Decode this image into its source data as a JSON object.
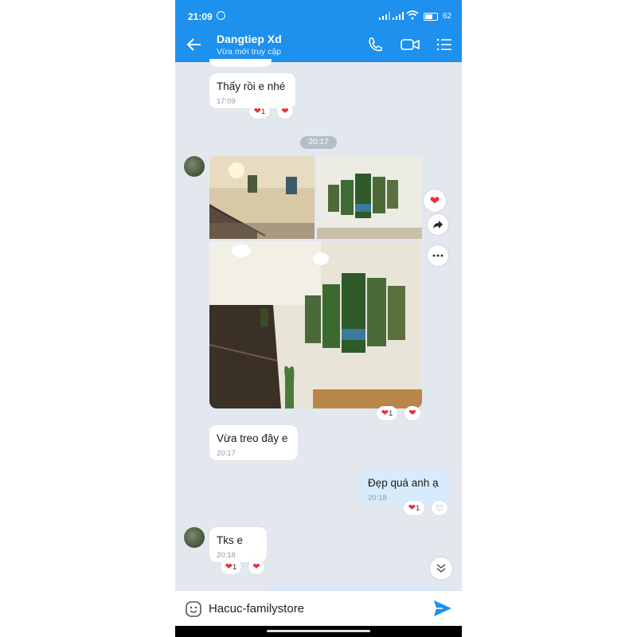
{
  "status_bar": {
    "time": "21:09",
    "battery": "62"
  },
  "header": {
    "name": "Dangtiep Xd",
    "status": "Vừa mới truy cập"
  },
  "messages": {
    "m1": {
      "text": "Thấy rồi e nhé",
      "time": "17:09",
      "reaction_count": "1"
    },
    "divider_time": "20:17",
    "m3": {
      "text": "Vừa treo đây e",
      "time": "20:17"
    },
    "photos_reaction_count": "1",
    "m4": {
      "text": "Đẹp quá anh ạ",
      "time": "20:18",
      "reaction_count": "1"
    },
    "m5": {
      "text": "Tks e",
      "time": "20:18",
      "reaction_count": "1"
    }
  },
  "composer": {
    "text": "Hacuc-familystore"
  },
  "colors": {
    "brand": "#1e90ee",
    "heart": "#e3313c",
    "chat_bg": "#e3e8ef",
    "my_bubble": "#d7ebfc"
  },
  "icons": [
    "back-arrow-icon",
    "phone-icon",
    "video-call-icon",
    "menu-icon",
    "heart-icon",
    "share-icon",
    "more-icon",
    "scroll-down-icon",
    "sticker-icon",
    "send-icon"
  ]
}
